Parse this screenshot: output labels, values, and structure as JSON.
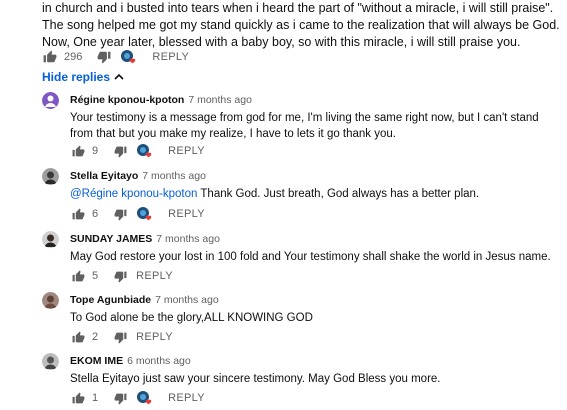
{
  "parent": {
    "text": "in church and i busted into tears when i heard the part of \"without a miracle, i will still praise\". The song helped me got my stand quickly as i came to the realization that will always be God. Now, One year later, blessed with a baby boy, so with this miracle, i will still praise you.",
    "likes": "296",
    "reply_label": "REPLY"
  },
  "hide_replies": {
    "label": "Hide replies",
    "icon": "chevron-up-icon"
  },
  "replies": [
    {
      "author": "Régine kponou-kpoton",
      "time": "7 months ago",
      "text": "Your testimony is a message from god for me, I'm living the same right now, but I can't stand from that but you make my realize, I have to lets it go thank you.",
      "likes": "9",
      "reply_label": "REPLY",
      "avatar_color": "#7e57c2"
    },
    {
      "author": "Stella Eyitayo",
      "time": "7 months ago",
      "mention": "@Régine kponou-kpoton",
      "text": " Thank God. Just breath, God always has a better plan.",
      "likes": "6",
      "reply_label": "REPLY",
      "avatar_color": "#4a4a4a"
    },
    {
      "author": "SUNDAY JAMES",
      "time": "7 months ago",
      "text": "May God restore your lost in 100 fold and Your testimony shall shake the world in Jesus name.",
      "likes": "5",
      "reply_label": "REPLY",
      "avatar_color": "#3a2a20"
    },
    {
      "author": "Tope Agunbiade",
      "time": "7 months ago",
      "text": "To God alone be the glory,ALL KNOWING GOD",
      "likes": "2",
      "reply_label": "REPLY",
      "avatar_color": "#8d6e63"
    },
    {
      "author": "EKOM IME",
      "time": "6 months ago",
      "text": "Stella Eyitayo just saw your sincere testimony. May God Bless you more.",
      "likes": "1",
      "reply_label": "REPLY",
      "avatar_color": "#555555"
    }
  ],
  "colors": {
    "link": "#065fd4",
    "muted": "#606060",
    "heart": "#e53935"
  }
}
